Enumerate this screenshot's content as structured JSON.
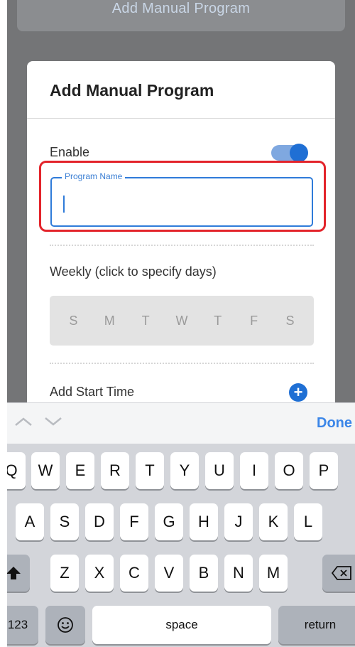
{
  "background_button": {
    "label": "Add Manual Program"
  },
  "modal": {
    "title": "Add Manual Program",
    "enable_label": "Enable",
    "enable_on": true,
    "program_name": {
      "label": "Program Name",
      "value": ""
    },
    "weekly_label": "Weekly (click to specify days)",
    "days": [
      "S",
      "M",
      "T",
      "W",
      "T",
      "F",
      "S"
    ],
    "add_start_time_label": "Add Start Time",
    "add_icon": "plus-circle-icon"
  },
  "keyboard": {
    "toolbar": {
      "prev_icon": "chevron-up-icon",
      "next_icon": "chevron-down-icon",
      "done_label": "Done"
    },
    "row1": [
      "Q",
      "W",
      "E",
      "R",
      "T",
      "Y",
      "U",
      "I",
      "O",
      "P"
    ],
    "row2": [
      "A",
      "S",
      "D",
      "F",
      "G",
      "H",
      "J",
      "K",
      "L"
    ],
    "row3": [
      "Z",
      "X",
      "C",
      "V",
      "B",
      "N",
      "M"
    ],
    "shift_icon": "shift-arrow-icon",
    "backspace_icon": "backspace-icon",
    "numbers_label": "123",
    "emoji_icon": "emoji-icon",
    "space_label": "space",
    "return_label": "return"
  },
  "colors": {
    "accent": "#1f6fd4",
    "highlight": "#e3242b",
    "overlay": "#747577"
  }
}
